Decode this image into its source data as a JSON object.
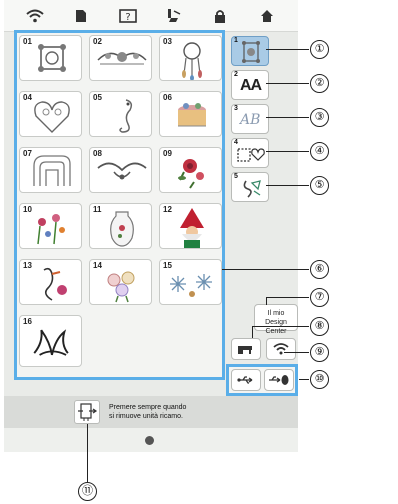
{
  "topbar": {
    "icons": [
      "wifi-icon",
      "document-icon",
      "help-icon",
      "presser-foot-icon",
      "lock-icon",
      "home-icon"
    ]
  },
  "patterns": [
    {
      "num": "01"
    },
    {
      "num": "02"
    },
    {
      "num": "03"
    },
    {
      "num": "04"
    },
    {
      "num": "05"
    },
    {
      "num": "06"
    },
    {
      "num": "07"
    },
    {
      "num": "08"
    },
    {
      "num": "09"
    },
    {
      "num": "10"
    },
    {
      "num": "11"
    },
    {
      "num": "12"
    },
    {
      "num": "13"
    },
    {
      "num": "14"
    },
    {
      "num": "15"
    },
    {
      "num": "16"
    }
  ],
  "categories": [
    {
      "num": "1",
      "icon": "embroidery-pattern-icon",
      "selected": true
    },
    {
      "num": "2",
      "icon": "alphabet-font-icon",
      "text": "AA"
    },
    {
      "num": "3",
      "icon": "decorative-alphabet-icon",
      "text": "AB"
    },
    {
      "num": "4",
      "icon": "frame-pattern-icon"
    },
    {
      "num": "5",
      "icon": "utility-pattern-icon"
    }
  ],
  "design_center": {
    "line1": "Il mio",
    "line2": "Design Center"
  },
  "message": {
    "line1": "Premere sempre quando",
    "line2": "si rimuove unità ricamo."
  },
  "callouts": [
    "①",
    "②",
    "③",
    "④",
    "⑤",
    "⑥",
    "⑦",
    "⑧",
    "⑨",
    "⑩",
    "⑪"
  ],
  "colors": {
    "accent": "#5aaee8",
    "selected": "#a9cbe6",
    "screen": "#e9ebe8"
  }
}
